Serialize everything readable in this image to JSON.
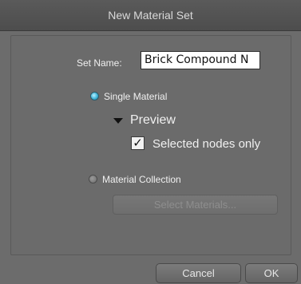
{
  "dialog": {
    "title": "New Material Set",
    "set_name_label": "Set Name:",
    "set_name_value": "Brick Compound N",
    "options": {
      "single_material_label": "Single Material",
      "single_material_selected": true,
      "preview_label": "Preview",
      "selected_nodes_only_label": "Selected nodes only",
      "selected_nodes_only_checked": true,
      "material_collection_label": "Material Collection",
      "material_collection_selected": false,
      "select_materials_label": "Select Materials..."
    },
    "buttons": {
      "cancel": "Cancel",
      "ok": "OK"
    }
  },
  "icons": {
    "radio_selected": "radio-selected-icon",
    "radio_unselected": "radio-unselected-icon",
    "disclosure": "triangle-down-icon",
    "checkbox": "checkmark-icon"
  },
  "colors": {
    "dialog_bg": "#6c6c6c",
    "titlebar_bg": "#525252",
    "radio_accent": "#3fb4d8"
  }
}
